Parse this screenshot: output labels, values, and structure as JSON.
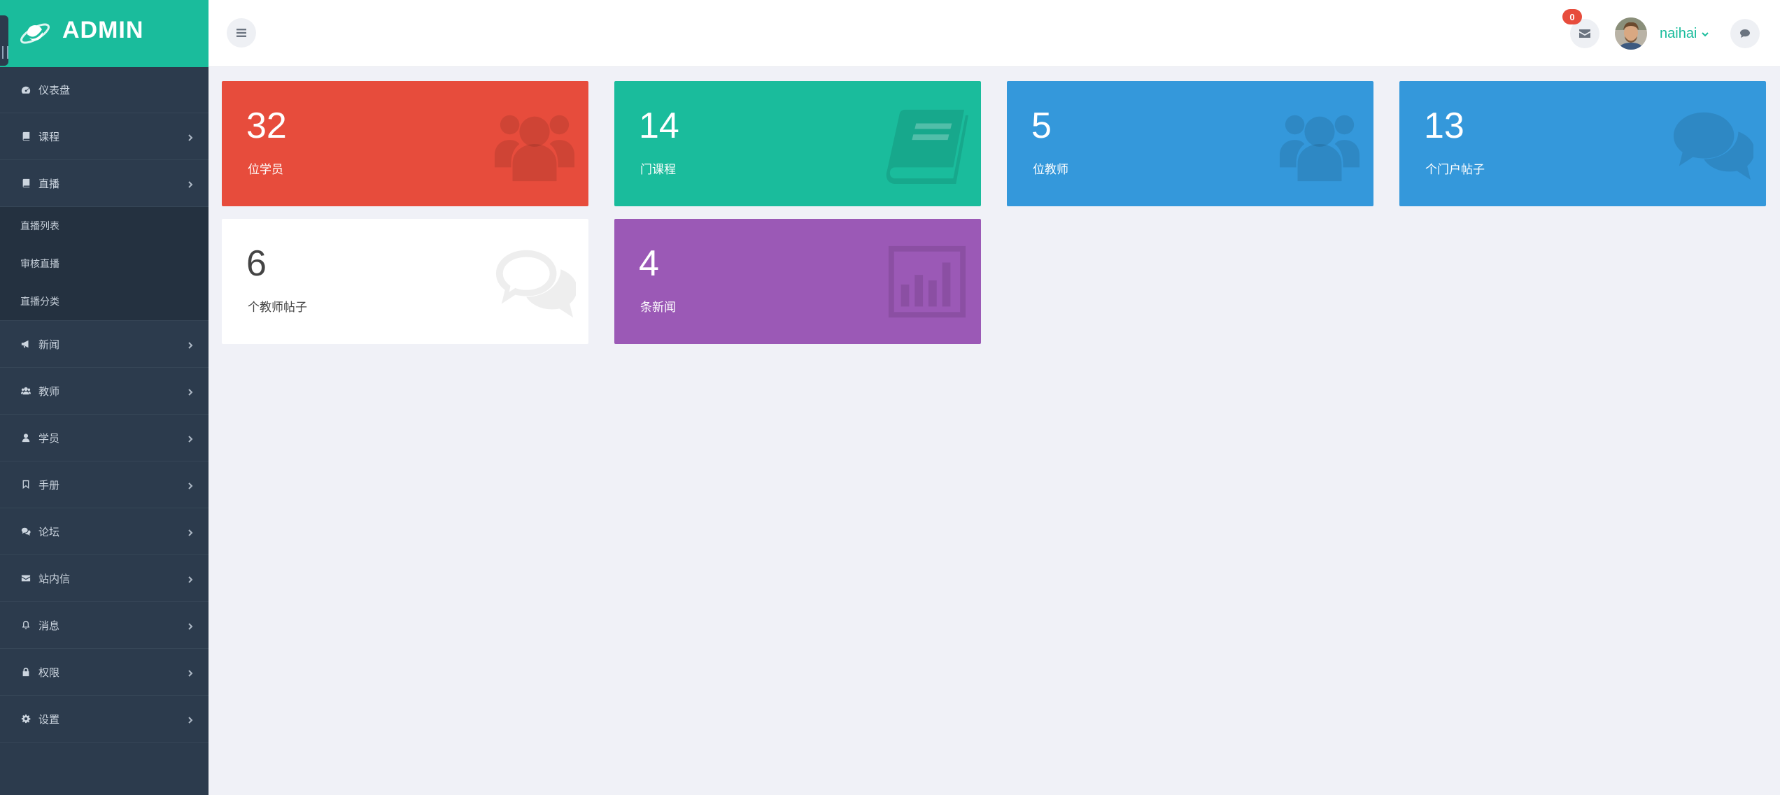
{
  "brand": {
    "title": "ADMIN"
  },
  "sidebar": {
    "items": [
      {
        "label": "仪表盘",
        "icon": "dashboard-icon",
        "has_children": false
      },
      {
        "label": "课程",
        "icon": "book-icon",
        "has_children": true
      },
      {
        "label": "直播",
        "icon": "book-icon",
        "has_children": true,
        "expanded": true,
        "children": [
          "直播列表",
          "审核直播",
          "直播分类"
        ]
      },
      {
        "label": "新闻",
        "icon": "bullhorn-icon",
        "has_children": true
      },
      {
        "label": "教师",
        "icon": "users-icon",
        "has_children": true
      },
      {
        "label": "学员",
        "icon": "user-icon",
        "has_children": true
      },
      {
        "label": "手册",
        "icon": "bookmark-icon",
        "has_children": true
      },
      {
        "label": "论坛",
        "icon": "comments-icon",
        "has_children": true
      },
      {
        "label": "站内信",
        "icon": "envelope-icon",
        "has_children": true
      },
      {
        "label": "消息",
        "icon": "bell-icon",
        "has_children": true
      },
      {
        "label": "权限",
        "icon": "lock-icon",
        "has_children": true
      },
      {
        "label": "设置",
        "icon": "gear-icon",
        "has_children": true
      }
    ]
  },
  "header": {
    "mail_badge": "0",
    "user_name": "naihai"
  },
  "cards": [
    {
      "value": "32",
      "label": "位学员",
      "color": "#e74c3c",
      "icon": "users-icon"
    },
    {
      "value": "14",
      "label": "门课程",
      "color": "#1abc9c",
      "icon": "book-icon"
    },
    {
      "value": "5",
      "label": "位教师",
      "color": "#3498db",
      "icon": "users-icon"
    },
    {
      "value": "13",
      "label": "个门户帖子",
      "color": "#3498db",
      "icon": "comments-icon"
    },
    {
      "value": "6",
      "label": "个教师帖子",
      "color": "#ffffff",
      "icon": "comments-icon"
    },
    {
      "value": "4",
      "label": "条新闻",
      "color": "#9b59b6",
      "icon": "bar-chart-icon"
    }
  ],
  "colors": {
    "sidebar_bg": "#2c3b4d",
    "accent": "#1abc9c",
    "page_bg": "#f0f1f7"
  }
}
